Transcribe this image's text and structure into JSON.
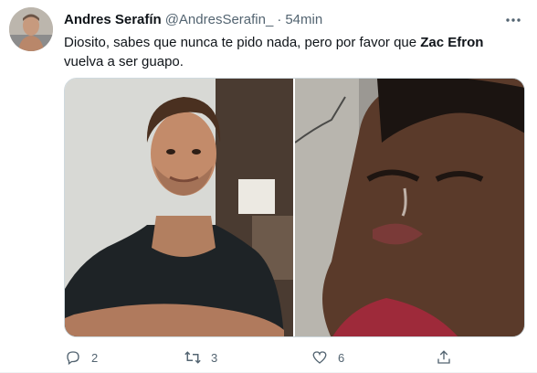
{
  "tweet": {
    "author_name": "Andres Serafín",
    "author_handle": "@AndresSerafin_",
    "separator": "·",
    "time": "54min",
    "text_before": "Diosito, sabes que nunca te pido nada, pero por favor que ",
    "text_bold": "Zac Efron",
    "text_after": " vuelva a ser guapo.",
    "media": [
      {
        "icon": "photo-man-smiling-black-tshirt"
      },
      {
        "icon": "photo-man-crying"
      }
    ],
    "actions": {
      "reply_count": "2",
      "retweet_count": "3",
      "like_count": "6"
    }
  },
  "colors": {
    "text_primary": "#0f1419",
    "text_secondary": "#536471",
    "border": "#cfd9de"
  }
}
